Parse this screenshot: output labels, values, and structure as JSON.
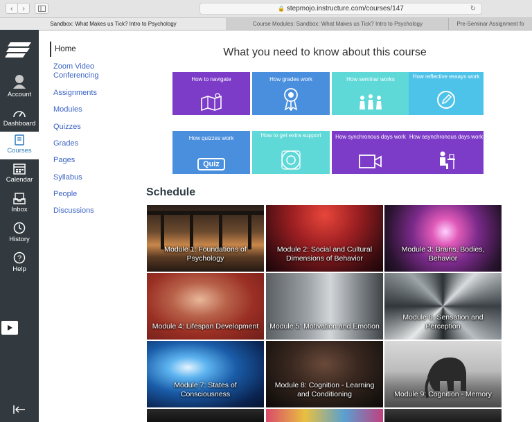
{
  "browser": {
    "url": "stepmojo.instructure.com/courses/147",
    "tabs": [
      "Sandbox: What Makes us Tick? Intro to Psychology",
      "Course Modules: Sandbox: What Makes us Tick? Intro to Psychology",
      "Pre-Seminar Assignment fo"
    ]
  },
  "global_nav": {
    "items": [
      {
        "label": "Account",
        "icon": "account-icon"
      },
      {
        "label": "Dashboard",
        "icon": "dashboard-icon"
      },
      {
        "label": "Courses",
        "icon": "courses-icon"
      },
      {
        "label": "Calendar",
        "icon": "calendar-icon"
      },
      {
        "label": "Inbox",
        "icon": "inbox-icon"
      },
      {
        "label": "History",
        "icon": "history-icon"
      },
      {
        "label": "Help",
        "icon": "help-icon"
      }
    ]
  },
  "course_nav": {
    "home": "Home",
    "items": [
      "Zoom Video Conferencing",
      "Assignments",
      "Modules",
      "Quizzes",
      "Grades",
      "Pages",
      "Syllabus",
      "People",
      "Discussions"
    ]
  },
  "main": {
    "heading": "What you need to know about this course",
    "tiles": [
      {
        "label": "How to navigate",
        "color": "#7d3cc8"
      },
      {
        "label": "How grades work",
        "color": "#4a8fde"
      },
      {
        "label": "How seminar works",
        "color": "#5fd8d8"
      },
      {
        "label": "How reflective essays work",
        "color": "#4ec3ea"
      },
      {
        "label": "How quizzes work",
        "color": "#4a8fde",
        "icon_text": "Quiz"
      },
      {
        "label": "How to get extra support",
        "color": "#5fd8d8"
      },
      {
        "label": "How synchronous days work",
        "color": "#7d3cc8"
      },
      {
        "label": "How asynchronous days work",
        "color": "#7d3cc8"
      }
    ],
    "schedule_heading": "Schedule",
    "modules": [
      "Module 1: Foundations of Psychology",
      "Module 2: Social and Cultural Dimensions of Behavior",
      "Module 3: Brains, Bodies, Behavior",
      "Module 4: Lifespan Development",
      "Module 5: Motivation and Emotion",
      "Module 6: Sensation and Perception",
      "Module 7: States of Consciousness",
      "Module 8: Cognition - Learning and Conditioning",
      "Module 9: Cognition - Memory"
    ]
  }
}
